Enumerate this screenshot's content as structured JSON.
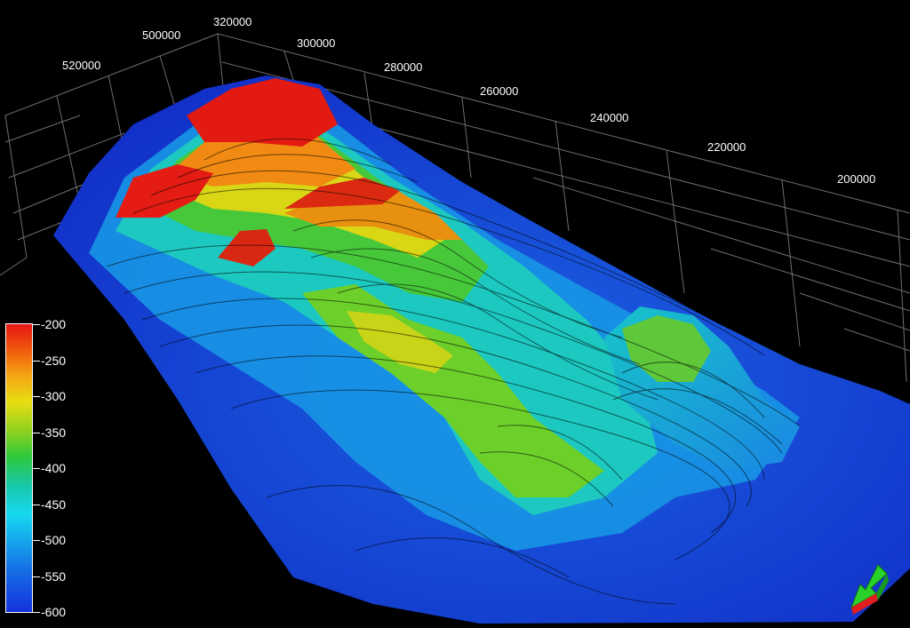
{
  "viewer": {
    "y_axis_ticks": [
      "520000",
      "500000"
    ],
    "x_axis_ticks": [
      "320000",
      "300000",
      "280000",
      "260000",
      "240000",
      "220000",
      "200000"
    ]
  },
  "colorbar": {
    "ticks": [
      "-200",
      "-250",
      "-300",
      "-350",
      "-400",
      "-450",
      "-500",
      "-550",
      "-600"
    ],
    "colors": [
      "#e81515",
      "#f5a614",
      "#e8de12",
      "#2fc83c",
      "#17d8f0",
      "#1670e6",
      "#1432dd"
    ]
  },
  "orientation_indicator": {
    "icon": "3d-orientation-arrow-icon"
  }
}
